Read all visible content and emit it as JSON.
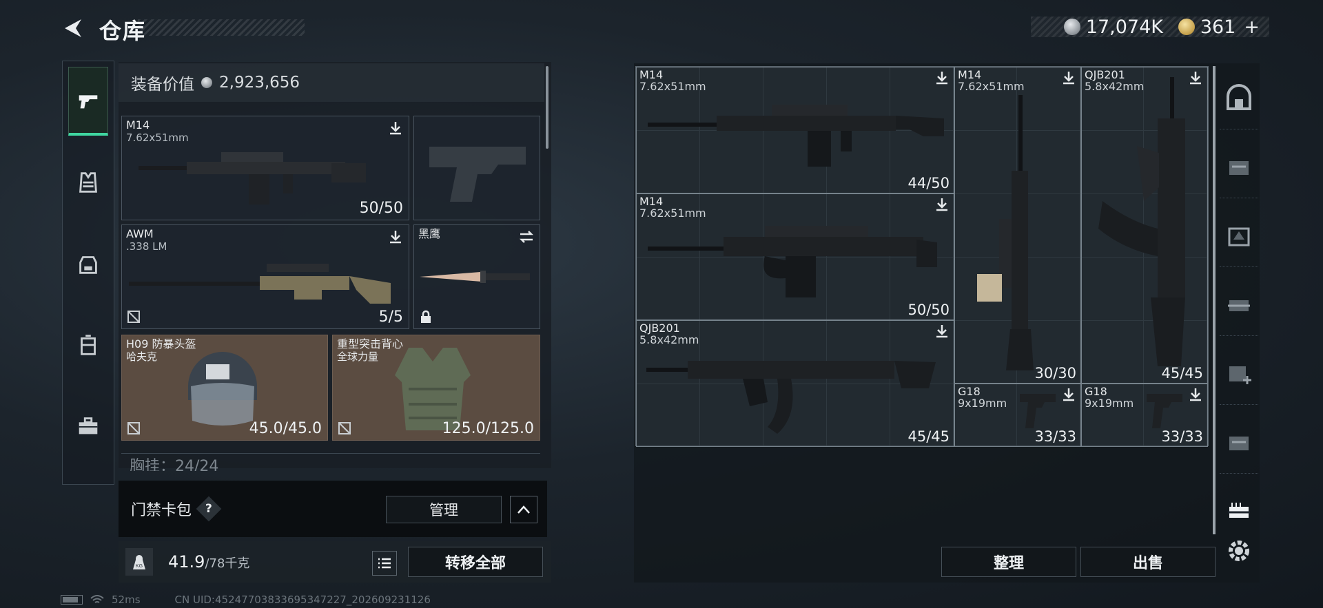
{
  "header": {
    "title": "仓库"
  },
  "currency": {
    "silver": "17,074K",
    "gold": "361",
    "add_symbol": "+"
  },
  "equipment": {
    "value_label": "装备价值",
    "value": "2,923,656",
    "slots": [
      {
        "name": "M14",
        "caliber": "7.62x51mm",
        "count": "50/50"
      },
      {
        "name": "",
        "caliber": "",
        "count": ""
      },
      {
        "name": "AWM",
        "caliber": ".338 LM",
        "count": "5/5"
      },
      {
        "name": "黑鹰",
        "caliber": "",
        "count": ""
      },
      {
        "name": "H09 防暴头盔",
        "caliber": "哈夫克",
        "count": "45.0/45.0"
      },
      {
        "name": "重型突击背心",
        "caliber": "全球力量",
        "count": "125.0/125.0"
      }
    ],
    "chest_rig": "胸挂：24/24"
  },
  "keycard": {
    "label": "门禁卡包",
    "help": "?",
    "manage": "管理"
  },
  "weight": {
    "current": "41.9",
    "max": "/78千克",
    "kg_icon": "KG",
    "transfer_all": "转移全部"
  },
  "stash": {
    "items": [
      {
        "name": "M14",
        "caliber": "7.62x51mm",
        "count": "44/50"
      },
      {
        "name": "M14",
        "caliber": "7.62x51mm",
        "count": "30/30"
      },
      {
        "name": "QJB201",
        "caliber": "5.8x42mm",
        "count": "45/45"
      },
      {
        "name": "M14",
        "caliber": "7.62x51mm",
        "count": "50/50"
      },
      {
        "name": "QJB201",
        "caliber": "5.8x42mm",
        "count": "45/45"
      },
      {
        "name": "G18",
        "caliber": "9x19mm",
        "count": "33/33"
      },
      {
        "name": "G18",
        "caliber": "9x19mm",
        "count": "33/33"
      }
    ],
    "sort": "整理",
    "sell": "出售"
  },
  "footer": {
    "ping": "52ms",
    "uid": "CN UID:452477038336953472​27_202609231126"
  },
  "colors": {
    "accent": "#3fd6a0",
    "brown_slot": "#5b4c41"
  }
}
